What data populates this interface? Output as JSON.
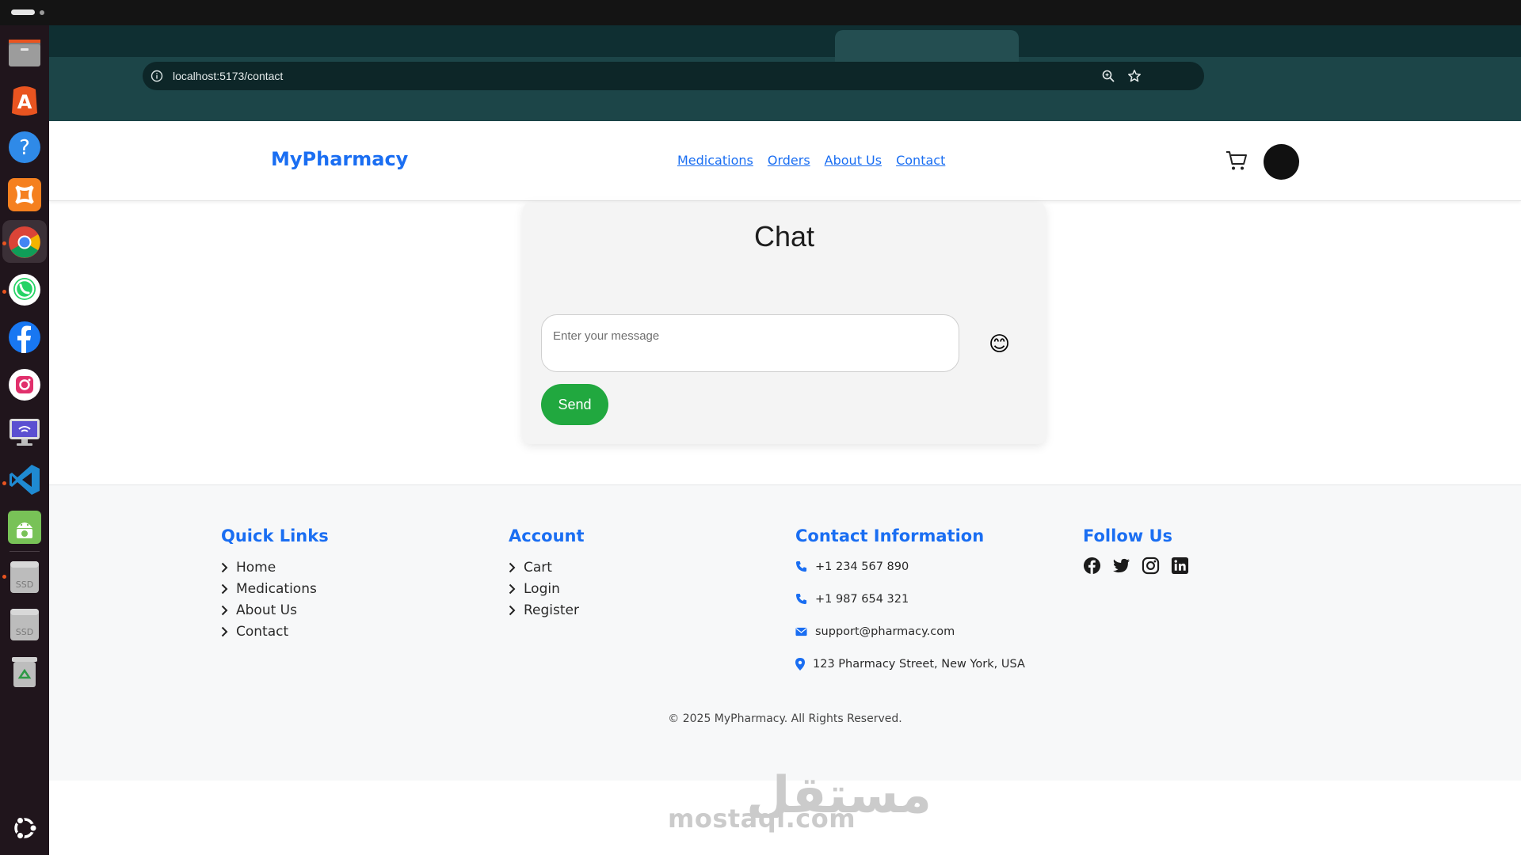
{
  "browser": {
    "url": "localhost:5173/contact"
  },
  "dock": {
    "icons": [
      "files-icon",
      "app-center-icon",
      "help-icon",
      "xampp-icon",
      "chrome-icon",
      "whatsapp-icon",
      "facebook-icon",
      "instagram-icon",
      "remote-desktop-icon",
      "vscode-icon",
      "android-studio-icon",
      "ssd-drive-icon",
      "ssd-drive-icon",
      "trash-icon",
      "ubuntu-icon"
    ],
    "drive_labels": [
      "SSD",
      "SSD"
    ]
  },
  "navbar": {
    "brand": "MyPharmacy",
    "links": [
      "Medications",
      "Orders",
      "About Us",
      "Contact"
    ],
    "cart_icon": "shopping-cart-icon",
    "avatar_color": "#111111"
  },
  "chat": {
    "title": "Chat",
    "input_placeholder": "Enter your message",
    "input_value": "",
    "emoji": "😊",
    "send_label": "Send"
  },
  "footer": {
    "quick_links": {
      "title": "Quick Links",
      "items": [
        "Home",
        "Medications",
        "About Us",
        "Contact"
      ]
    },
    "account": {
      "title": "Account",
      "items": [
        "Cart",
        "Login",
        "Register"
      ]
    },
    "contact": {
      "title": "Contact Information",
      "phone1": "+1 234 567 890",
      "phone2": "+1 987 654 321",
      "email": "support@pharmacy.com",
      "address": "123 Pharmacy Street, New York, USA"
    },
    "follow": {
      "title": "Follow Us",
      "icons": [
        "facebook-icon",
        "twitter-icon",
        "instagram-icon",
        "linkedin-icon"
      ]
    },
    "copyright": "© 2025 MyPharmacy. All Rights Reserved."
  },
  "watermark": {
    "text": "mostaql.com",
    "logo_text": "مستقل"
  },
  "colors": {
    "brand_blue": "#1a6ef2",
    "send_green": "#21a83f",
    "browser_frame": "#1c4548",
    "dock_bg": "#20151c"
  }
}
